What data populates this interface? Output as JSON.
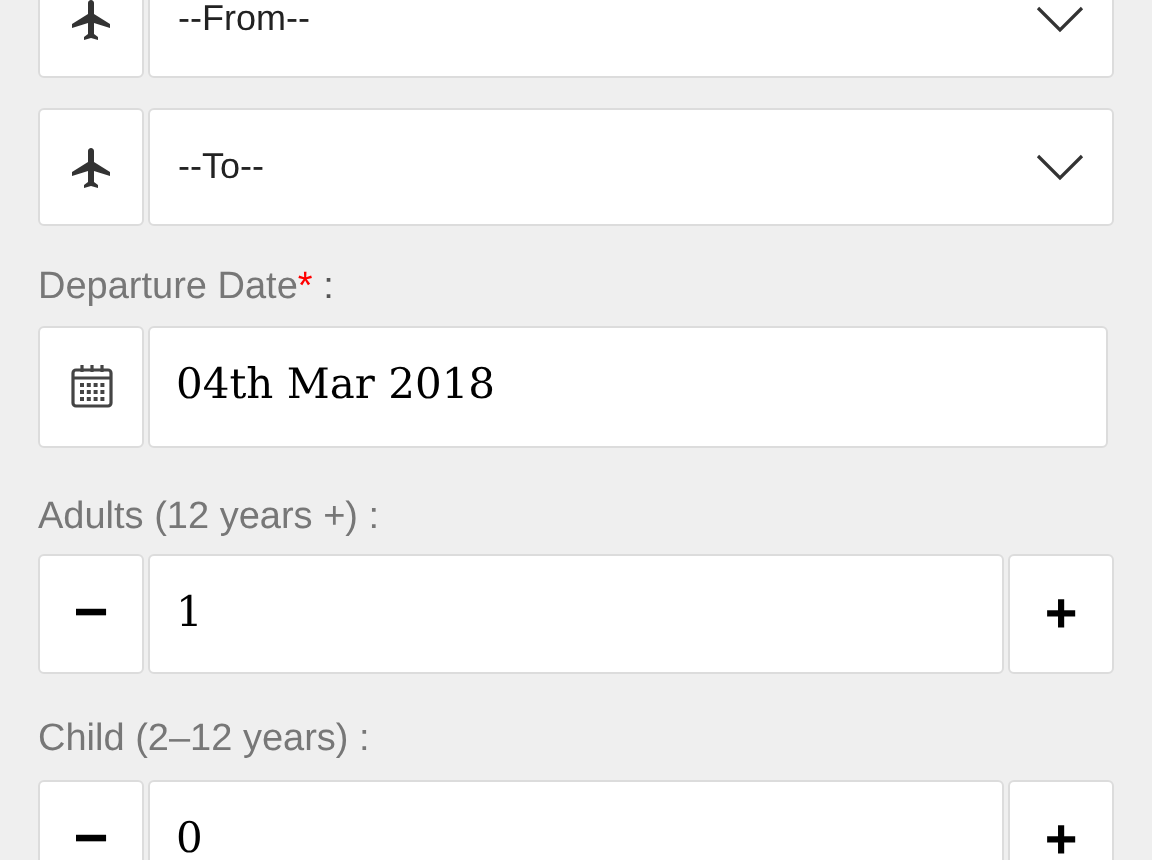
{
  "route": [
    {
      "kind": "select",
      "placeholder": "--From--"
    },
    {
      "kind": "select",
      "placeholder": "--To--"
    }
  ],
  "departure": {
    "label": "Departure Date",
    "required_mark": "*",
    "suffix": " :",
    "value": "04th Mar 2018"
  },
  "counters": [
    {
      "label": "Adults (12 years +) :",
      "value": "1",
      "minus": "−",
      "plus": "+"
    },
    {
      "label": "Child (2–12 years) :",
      "value": "0",
      "minus": "−",
      "plus": "+"
    }
  ]
}
